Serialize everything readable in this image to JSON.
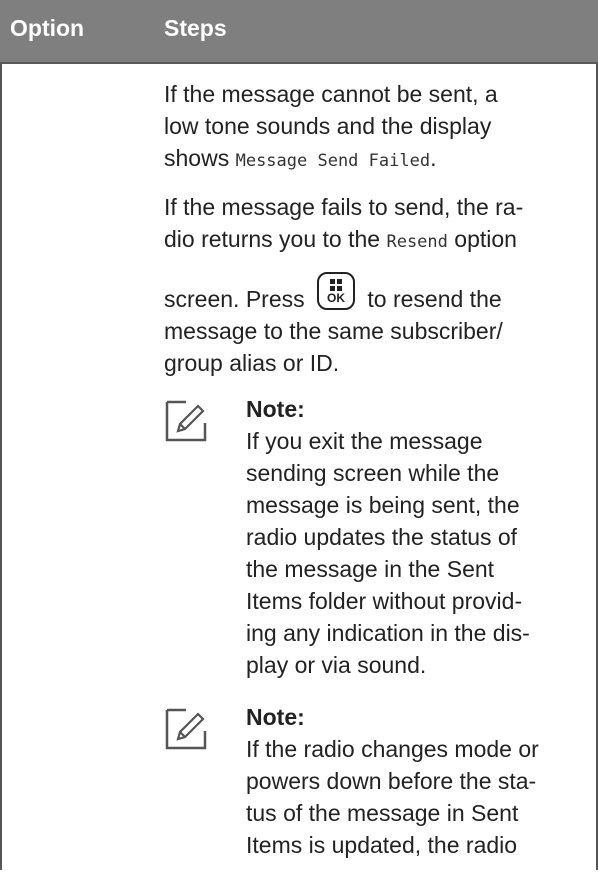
{
  "header": {
    "option": "Option",
    "steps": "Steps"
  },
  "steps": {
    "p1_a": "If the message cannot be sent, a",
    "p1_b": "low tone sounds and the display",
    "p1_c_prefix": "shows ",
    "p1_c_mono": "Message Send Failed",
    "p1_c_suffix": ".",
    "p2_a": "If the message fails to send, the ra-",
    "p2_b_prefix": "dio returns you to the ",
    "p2_b_mono": "Resend",
    "p2_b_suffix": " option",
    "p2_c_prefix": "screen. Press ",
    "p2_c_suffix": " to resend the",
    "p2_d": "message to the same subscriber/",
    "p2_e": "group alias or ID.",
    "ok_key_label": "OK"
  },
  "notes": [
    {
      "title": "Note:",
      "lines": [
        "If you exit the message",
        "sending screen while the",
        "message is being sent, the",
        "radio updates the status of",
        "the message in the Sent",
        "Items folder without provid-",
        "ing any indication in the dis-",
        "play or via sound."
      ]
    },
    {
      "title": "Note:",
      "lines": [
        "If the radio changes mode or",
        "powers down before the sta-",
        "tus of the message in Sent",
        "Items is updated, the radio"
      ]
    }
  ]
}
